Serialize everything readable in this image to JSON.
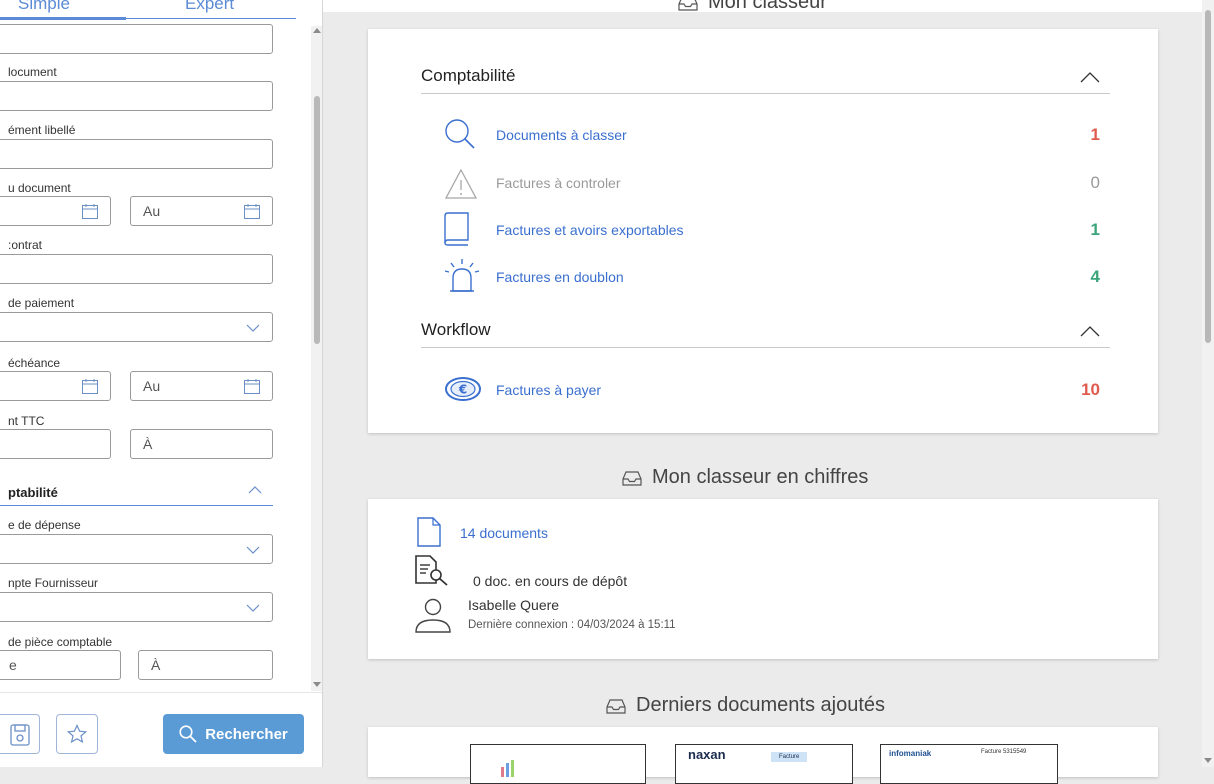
{
  "left_panel": {
    "tabs": {
      "simple": "Simple",
      "expert": "Expert"
    },
    "fields": {
      "document_label": "locument",
      "libelle_label": "ément libellé",
      "date_doc_label": "u document",
      "date_doc_to_placeholder": "Au",
      "contrat_label": ":ontrat",
      "paiement_label": "de paiement",
      "echeance_label": "échéance",
      "echeance_to_placeholder": "Au",
      "ttc_label": "nt TTC",
      "ttc_to_placeholder": "À",
      "section_title": "ptabilité",
      "depense_label": "e de dépense",
      "fournisseur_label": "npte Fournisseur",
      "piece_label": "de pièce comptable",
      "piece_from_placeholder": "e",
      "piece_to_placeholder": "À"
    },
    "search_button": "Rechercher"
  },
  "main": {
    "mon_classeur_header": "Mon classeur",
    "groups": {
      "comptabilite": {
        "title": "Comptabilité",
        "rows": [
          {
            "label": "Documents à classer",
            "count": "1",
            "color": "#e05a4e"
          },
          {
            "label": "Factures à controler",
            "count": "0",
            "color": "#9a9a9a"
          },
          {
            "label": "Factures et avoirs exportables",
            "count": "1",
            "color": "#3aa57a"
          },
          {
            "label": "Factures en doublon",
            "count": "4",
            "color": "#3aa57a"
          }
        ]
      },
      "workflow": {
        "title": "Workflow",
        "rows": [
          {
            "label": "Factures à payer",
            "count": "10",
            "color": "#e05a4e"
          }
        ]
      }
    },
    "chiffres": {
      "header": "Mon classeur en chiffres",
      "documents": "14 documents",
      "depot": "0 doc. en cours de dépôt",
      "user_name": "Isabelle Quere",
      "last_login": "Dernière connexion : 04/03/2024 à 15:11"
    },
    "derniers": {
      "header": "Derniers documents ajoutés",
      "thumbs": [
        {
          "brand": ""
        },
        {
          "brand": "naxan",
          "tag": "Facture"
        },
        {
          "brand": "infomaniak",
          "ref": "Facture 5315549"
        }
      ]
    }
  },
  "colors": {
    "accent": "#5b8bd6",
    "link": "#3a6fcf",
    "red": "#e05a4e",
    "green": "#3aa57a",
    "button": "#5b9bd5"
  }
}
